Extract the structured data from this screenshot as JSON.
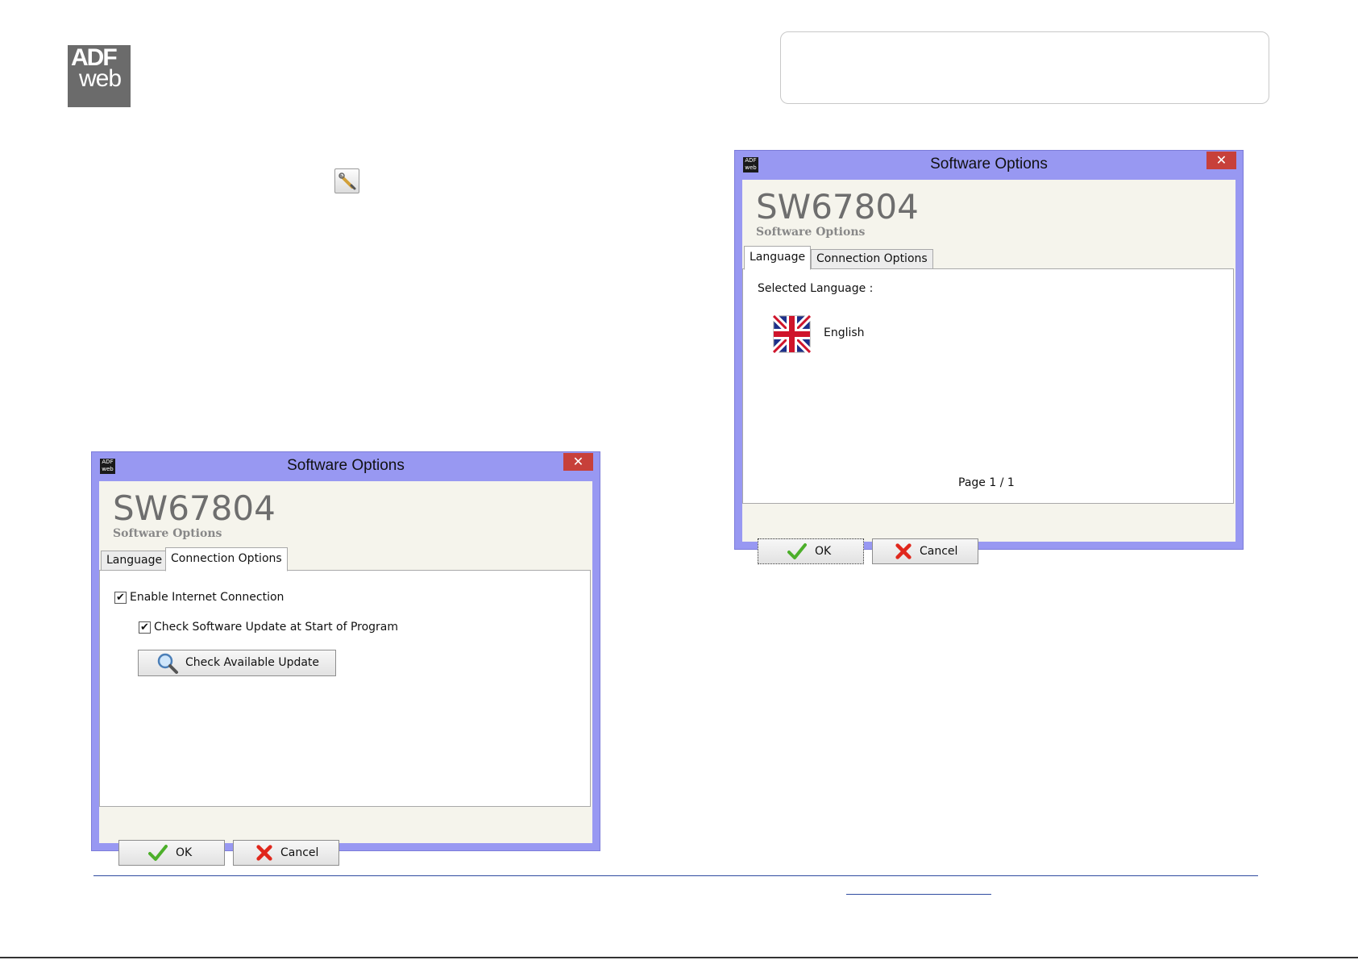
{
  "logo": {
    "line1": "ADF",
    "line2": "web"
  },
  "window_title": "Software Options",
  "close_glyph": "✕",
  "titlebar_icon_text": "ADF web",
  "product_code": "SW67804",
  "product_subtitle": "Software Options",
  "tabs": {
    "language": "Language",
    "connection": "Connection Options"
  },
  "connection_tab": {
    "enable_internet": {
      "label": "Enable Internet Connection",
      "checked": true
    },
    "check_update_at_start": {
      "label": "Check Software Update at Start of Program",
      "checked": true
    },
    "check_button": "Check Available Update"
  },
  "language_tab": {
    "selected_label": "Selected Language :",
    "language_name": "English",
    "pagination": "Page 1 / 1"
  },
  "buttons": {
    "ok": "OK",
    "cancel": "Cancel"
  },
  "check_glyph": "✔",
  "icons": {
    "tool": "wrench-icon",
    "ok": "checkmark-icon",
    "cancel": "red-x-icon",
    "search": "magnifier-icon",
    "flag": "uk-flag-icon"
  }
}
